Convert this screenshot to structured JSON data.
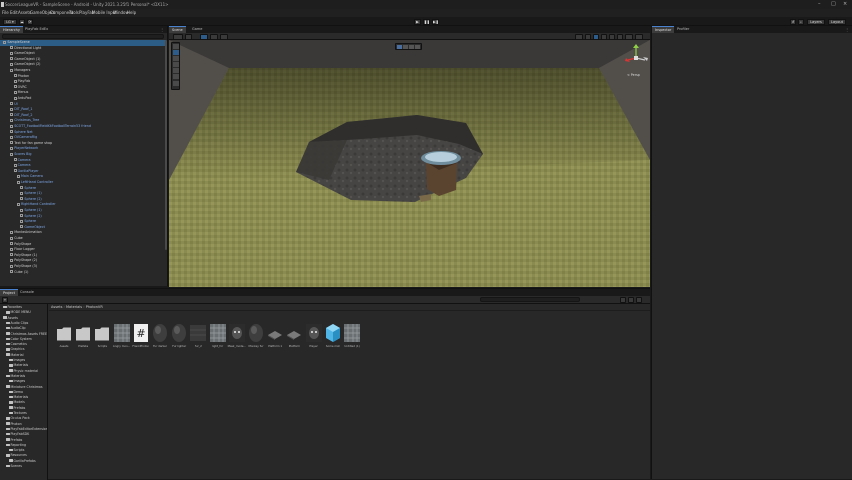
{
  "window": {
    "title": "SoccerLeagueVR - SampleScene - Android - Unity 2021.3.25f1 Personal* <DX11>",
    "minimize": "–",
    "maximize": "□",
    "close": "×"
  },
  "menu": [
    "File",
    "Edit",
    "Assets",
    "GameObject",
    "Component",
    "Tools",
    "PlayFab",
    "Mobile Input",
    "Window",
    "Help"
  ],
  "toolbar": {
    "account_label": "LG ▾",
    "play": "▶",
    "pause": "❚❚",
    "step": "▶❚",
    "layers_label": "Layers",
    "layout_label": "Layout"
  },
  "hierarchy": {
    "tabs": [
      "Hierarchy",
      "PlayFab EdEx"
    ],
    "rows": [
      {
        "label": "SampleScene",
        "indent": 1,
        "blue": false,
        "selected": true
      },
      {
        "label": "Directional Light",
        "indent": 3,
        "blue": false
      },
      {
        "label": "GameObject",
        "indent": 3,
        "blue": false
      },
      {
        "label": "GameObject (1)",
        "indent": 3,
        "blue": false
      },
      {
        "label": "GameObject (2)",
        "indent": 3,
        "blue": false
      },
      {
        "label": "Managers",
        "indent": 3,
        "blue": false
      },
      {
        "label": "Photon",
        "indent": 4,
        "blue": false
      },
      {
        "label": "PlayFab",
        "indent": 4,
        "blue": false
      },
      {
        "label": "OVRC",
        "indent": 4,
        "blue": false
      },
      {
        "label": "Menus",
        "indent": 4,
        "blue": false
      },
      {
        "label": "ArduPad",
        "indent": 4,
        "blue": false
      },
      {
        "label": "UI",
        "indent": 3,
        "blue": true
      },
      {
        "label": "DIT_Roof_1",
        "indent": 3,
        "blue": true
      },
      {
        "label": "DIT_Roof_2",
        "indent": 3,
        "blue": true
      },
      {
        "label": "Christmas_Tree",
        "indent": 3,
        "blue": true
      },
      {
        "label": "SCOTT_FootballFieldKitFootballTerrain53 friend",
        "indent": 3,
        "blue": true
      },
      {
        "label": "Sphere Net",
        "indent": 3,
        "blue": true
      },
      {
        "label": "OVCameraRig",
        "indent": 3,
        "blue": true
      },
      {
        "label": "Text for fan game shop",
        "indent": 3,
        "blue": false
      },
      {
        "label": "PlayerNetwork",
        "indent": 3,
        "blue": true
      },
      {
        "label": "Scores Big",
        "indent": 3,
        "blue": true
      },
      {
        "label": "Camera",
        "indent": 4,
        "blue": true
      },
      {
        "label": "Camera",
        "indent": 4,
        "blue": true
      },
      {
        "label": "GorillaPlayer",
        "indent": 4,
        "blue": true
      },
      {
        "label": "Main Camera",
        "indent": 5,
        "blue": true
      },
      {
        "label": "LeftHand Controller",
        "indent": 5,
        "blue": true
      },
      {
        "label": "Sphere",
        "indent": 6,
        "blue": true
      },
      {
        "label": "Sphere (1)",
        "indent": 6,
        "blue": true
      },
      {
        "label": "Sphere (2)",
        "indent": 6,
        "blue": true
      },
      {
        "label": "RightHand Controller",
        "indent": 5,
        "blue": true
      },
      {
        "label": "Sphere (1)",
        "indent": 6,
        "blue": true
      },
      {
        "label": "Sphere (2)",
        "indent": 6,
        "blue": true
      },
      {
        "label": "Sphere",
        "indent": 6,
        "blue": true
      },
      {
        "label": "GameObject",
        "indent": 6,
        "blue": true
      },
      {
        "label": "MonkeAnimation",
        "indent": 3,
        "blue": false
      },
      {
        "label": "Cube",
        "indent": 3,
        "blue": false
      },
      {
        "label": "PolyShape",
        "indent": 3,
        "blue": false
      },
      {
        "label": "Floor Logger",
        "indent": 3,
        "blue": false
      },
      {
        "label": "PolyShape (1)",
        "indent": 3,
        "blue": false
      },
      {
        "label": "PolyShape (2)",
        "indent": 3,
        "blue": false
      },
      {
        "label": "PolyShape (3)",
        "indent": 3,
        "blue": false
      },
      {
        "label": "Cube (1)",
        "indent": 3,
        "blue": false
      }
    ]
  },
  "scene": {
    "tabs": [
      "Scene",
      "Game"
    ],
    "gizmo_label": "< Persp"
  },
  "inspector": {
    "tabs": [
      "Inspector",
      "Profiler"
    ]
  },
  "project": {
    "tabs": [
      "Project",
      "Console"
    ],
    "add_label": "+",
    "breadcrumb": [
      "Assets",
      "Materials",
      "PhotonVR"
    ],
    "tree": [
      {
        "label": "Favorites",
        "indent": 1
      },
      {
        "label": "MODE MENU",
        "indent": 2
      },
      {
        "label": "Assets",
        "indent": 1
      },
      {
        "label": "Audio Clips",
        "indent": 2
      },
      {
        "label": "AudioClip",
        "indent": 2
      },
      {
        "label": "Christmas Assets FREE",
        "indent": 2
      },
      {
        "label": "Color System",
        "indent": 2
      },
      {
        "label": "Cosmetics",
        "indent": 2
      },
      {
        "label": "Graphics",
        "indent": 2
      },
      {
        "label": "Material",
        "indent": 2
      },
      {
        "label": "Images",
        "indent": 3
      },
      {
        "label": "Materials",
        "indent": 3
      },
      {
        "label": "Physic material",
        "indent": 3
      },
      {
        "label": "Materials",
        "indent": 2
      },
      {
        "label": "Images",
        "indent": 3
      },
      {
        "label": "Miniature Christmas",
        "indent": 2
      },
      {
        "label": "Demo",
        "indent": 3
      },
      {
        "label": "Materials",
        "indent": 3
      },
      {
        "label": "Models",
        "indent": 3
      },
      {
        "label": "Prefabs",
        "indent": 3
      },
      {
        "label": "Textures",
        "indent": 3
      },
      {
        "label": "Oculus Pack",
        "indent": 2
      },
      {
        "label": "Photon",
        "indent": 2
      },
      {
        "label": "PlayFabEditorExtensions",
        "indent": 2
      },
      {
        "label": "PlayFabSDK",
        "indent": 2
      },
      {
        "label": "Prefabs",
        "indent": 2
      },
      {
        "label": "Reporting",
        "indent": 2
      },
      {
        "label": "Scripts",
        "indent": 3
      },
      {
        "label": "Resources",
        "indent": 2
      },
      {
        "label": "GorillaPrefabs",
        "indent": 3
      },
      {
        "label": "Scenes",
        "indent": 2
      }
    ],
    "assets": [
      {
        "label": "Assets",
        "kind": "folder"
      },
      {
        "label": "Prefabs",
        "kind": "folder"
      },
      {
        "label": "Scripts",
        "kind": "folder"
      },
      {
        "label": "Angry mon...",
        "kind": "pattern"
      },
      {
        "label": "FrankPhoton",
        "kind": "hash"
      },
      {
        "label": "Fur darker",
        "kind": "sphere"
      },
      {
        "label": "Fur lighter",
        "kind": "sphere"
      },
      {
        "label": "fur_2",
        "kind": "flat"
      },
      {
        "label": "light_for",
        "kind": "pattern"
      },
      {
        "label": "Mask_mode...",
        "kind": "monkey"
      },
      {
        "label": "Monkey fur",
        "kind": "sphere"
      },
      {
        "label": "Platform 1",
        "kind": "plate"
      },
      {
        "label": "Platform",
        "kind": "plate"
      },
      {
        "label": "Player",
        "kind": "monkey"
      },
      {
        "label": "Some mat",
        "kind": "cube"
      },
      {
        "label": "Untitled (1)",
        "kind": "pattern"
      }
    ]
  },
  "colors": {
    "accent": "#2c5d87",
    "panel": "#282828",
    "background": "#191919",
    "ground": "#8f9055",
    "wall": "#4a4845"
  }
}
